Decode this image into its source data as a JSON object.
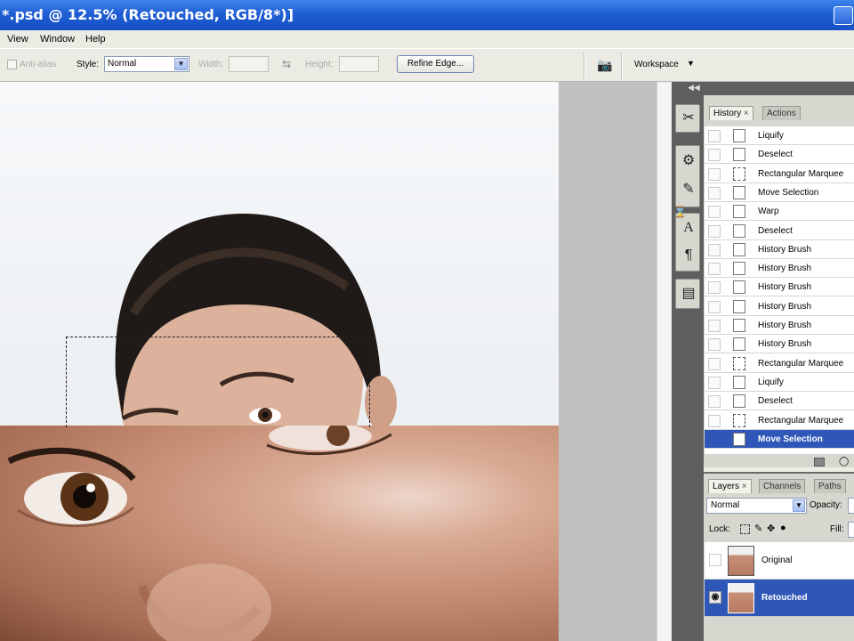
{
  "title_bar": {
    "title": "*.psd @ 12.5% (Retouched, RGB/8*)]"
  },
  "menu": [
    "View",
    "Window",
    "Help"
  ],
  "options_bar": {
    "antialias_label": "Anti-alias",
    "style_label": "Style:",
    "style_value": "Normal",
    "width_label": "Width:",
    "height_label": "Height:",
    "refine_edge_label": "Refine Edge...",
    "workspace_label": "Workspace"
  },
  "history_panel": {
    "tabs": [
      "History",
      "Actions"
    ],
    "items": [
      {
        "label": "Liquify",
        "icon": "document-icon"
      },
      {
        "label": "Deselect",
        "icon": "document-icon"
      },
      {
        "label": "Rectangular Marquee",
        "icon": "marquee-icon"
      },
      {
        "label": "Move Selection",
        "icon": "document-icon"
      },
      {
        "label": "Warp",
        "icon": "document-icon"
      },
      {
        "label": "Deselect",
        "icon": "document-icon"
      },
      {
        "label": "History Brush",
        "icon": "document-icon"
      },
      {
        "label": "History Brush",
        "icon": "document-icon"
      },
      {
        "label": "History Brush",
        "icon": "document-icon"
      },
      {
        "label": "History Brush",
        "icon": "document-icon"
      },
      {
        "label": "History Brush",
        "icon": "document-icon"
      },
      {
        "label": "History Brush",
        "icon": "document-icon"
      },
      {
        "label": "Rectangular Marquee",
        "icon": "marquee-icon"
      },
      {
        "label": "Liquify",
        "icon": "document-icon"
      },
      {
        "label": "Deselect",
        "icon": "document-icon"
      },
      {
        "label": "Rectangular Marquee",
        "icon": "marquee-icon"
      },
      {
        "label": "Move Selection",
        "icon": "document-icon",
        "selected": true
      }
    ]
  },
  "layers_panel": {
    "tabs": [
      "Layers",
      "Channels",
      "Paths"
    ],
    "blend_mode": "Normal",
    "opacity_label": "Opacity:",
    "lock_label": "Lock:",
    "fill_label": "Fill:",
    "layers": [
      {
        "name": "Original",
        "visible": false,
        "selected": false
      },
      {
        "name": "Retouched",
        "visible": true,
        "selected": true
      }
    ]
  },
  "colors": {
    "selection": "#2f57b8",
    "titlebar": "#1f5ed3",
    "panel_bg": "#d8d7cf",
    "dark_strip": "#5e5e5e"
  }
}
